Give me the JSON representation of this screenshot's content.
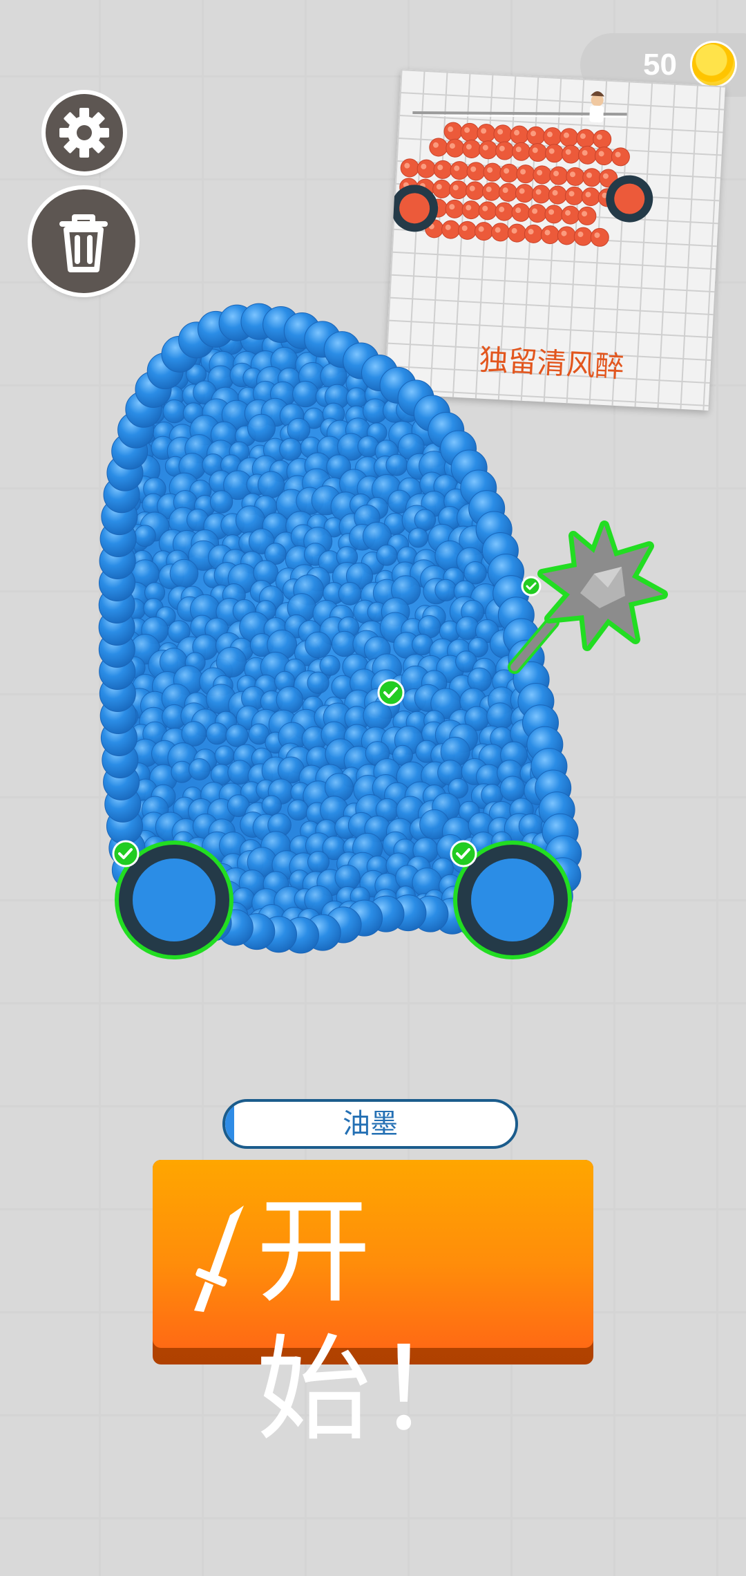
{
  "hud": {
    "coins": "50",
    "coin_icon": "coin-icon",
    "settings_icon": "gear-icon",
    "trash_icon": "trash-icon"
  },
  "preview": {
    "caption": "独留清风醉"
  },
  "ink": {
    "label": "油墨",
    "level": 0.03
  },
  "start_button": {
    "label": "开始！",
    "icon": "sword-icon"
  },
  "colors": {
    "accent_orange": "#ff8d0a",
    "ink_blue": "#2f8ce6",
    "vehicle_blue": "#2b8de6",
    "opponent_red": "#ec5a3a",
    "attachment_outline": "#22dd22"
  }
}
